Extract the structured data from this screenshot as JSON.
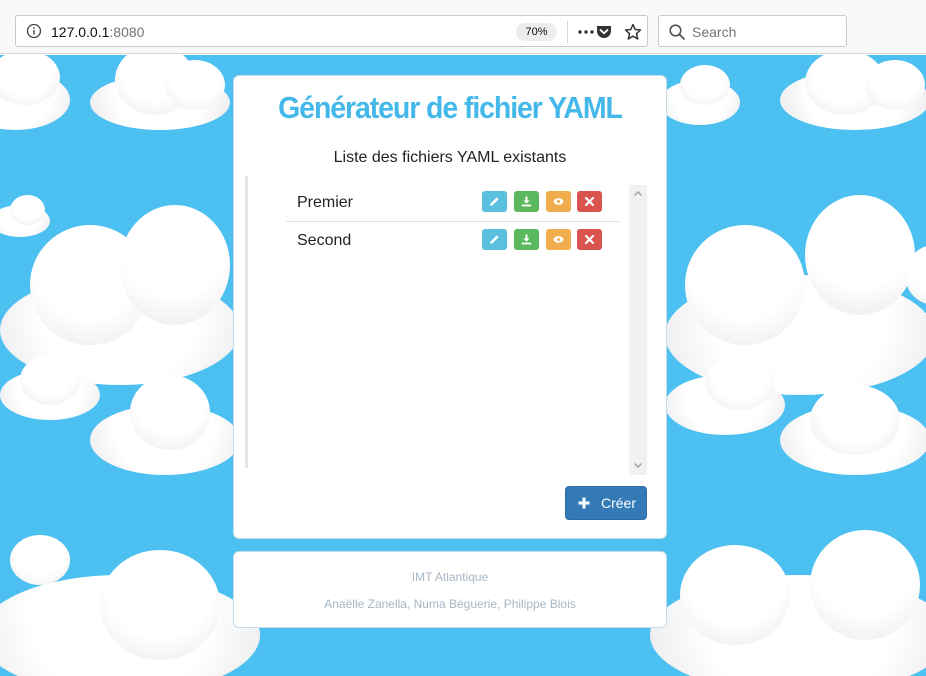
{
  "browser": {
    "url_host": "127.0.0.1",
    "url_port": ":8080",
    "zoom": "70%",
    "search_placeholder": "Search",
    "icons": [
      "info-icon",
      "more-icon",
      "pocket-icon",
      "bookmark-star-icon",
      "search-icon"
    ]
  },
  "app": {
    "title": "Générateur de fichier YAML",
    "list_heading": "Liste des fichiers YAML existants",
    "files": [
      {
        "name": "Premier"
      },
      {
        "name": "Second"
      }
    ],
    "row_actions": [
      "edit-icon",
      "download-icon",
      "view-icon",
      "delete-icon"
    ],
    "create_label": "Créer"
  },
  "footer": {
    "institution": "IMT Atlantique",
    "authors": "Anaëlle Zanella, Numa Béguerie, Philippe Blois"
  },
  "colors": {
    "sky": "#4cc0f0",
    "title": "#45b8ea",
    "edit": "#5bc0de",
    "download": "#5cb85c",
    "view": "#f0ad4e",
    "delete": "#d9534f",
    "primary": "#337ab7"
  }
}
